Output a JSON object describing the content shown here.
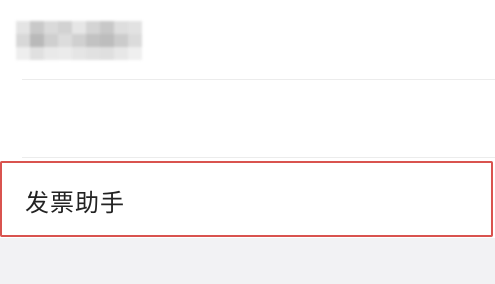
{
  "list": {
    "items": [
      {
        "label": "",
        "state": "obscured"
      },
      {
        "label": "",
        "state": "obscured"
      },
      {
        "label": "发票助手",
        "state": "highlighted"
      }
    ]
  },
  "colors": {
    "highlight_border": "#d9534f",
    "background": "#ffffff",
    "footer_background": "#f2f2f4",
    "divider": "#ececec"
  }
}
